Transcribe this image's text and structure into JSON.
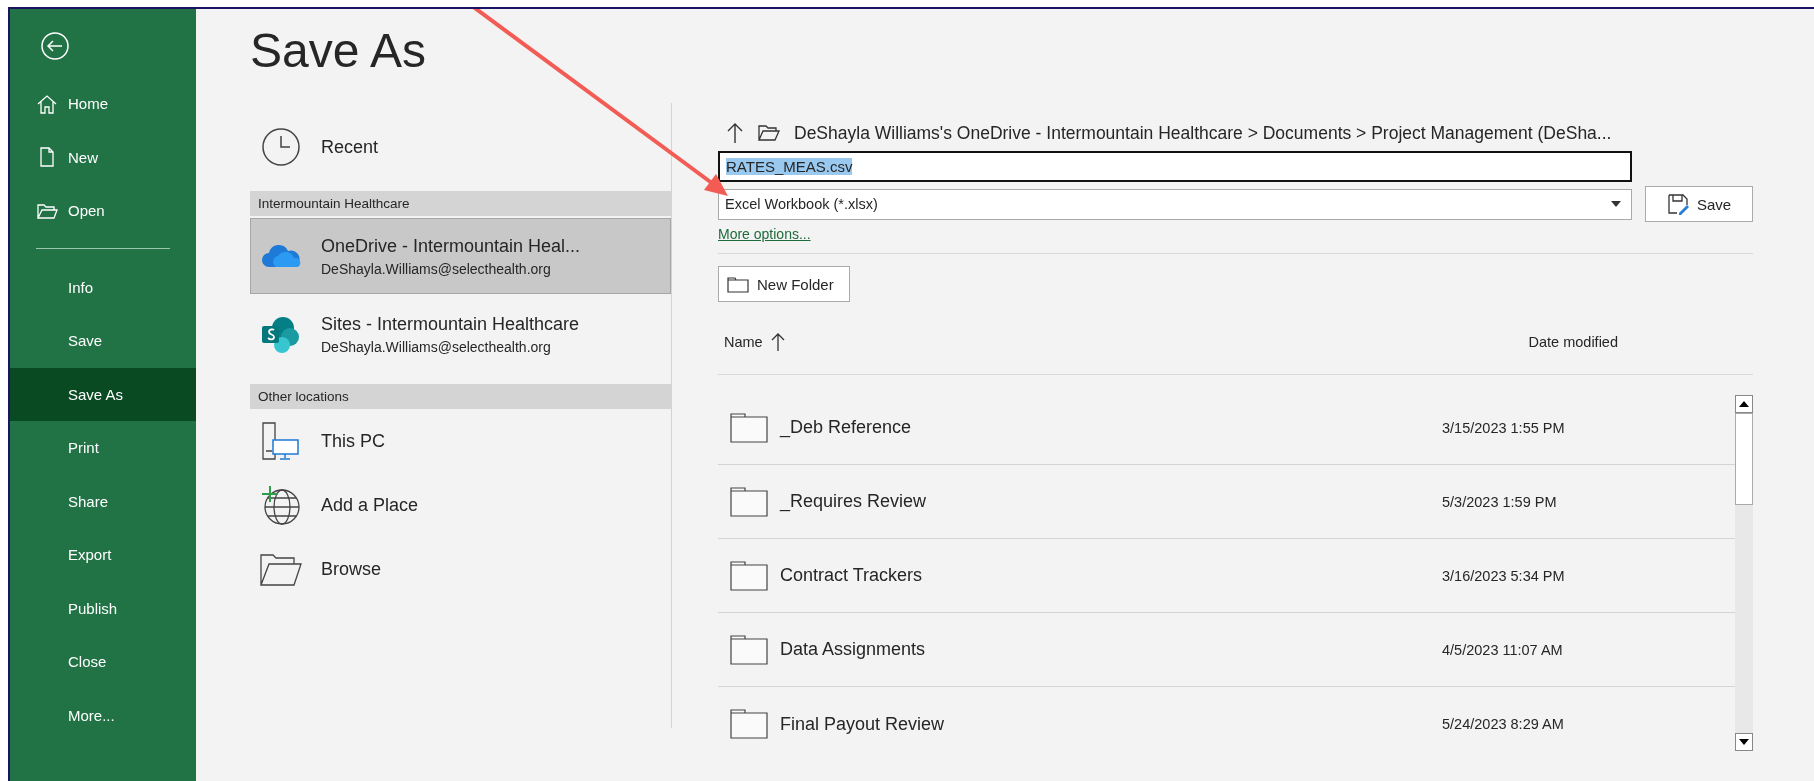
{
  "nav_top": [
    {
      "label": "Home",
      "selected": false
    },
    {
      "label": "New",
      "selected": false
    },
    {
      "label": "Open",
      "selected": false
    }
  ],
  "nav_items": [
    {
      "label": "Info",
      "selected": false
    },
    {
      "label": "Save",
      "selected": false
    },
    {
      "label": "Save As",
      "selected": true
    },
    {
      "label": "Print",
      "selected": false
    },
    {
      "label": "Share",
      "selected": false
    },
    {
      "label": "Export",
      "selected": false
    },
    {
      "label": "Publish",
      "selected": false
    },
    {
      "label": "Close",
      "selected": false
    },
    {
      "label": "More...",
      "selected": false
    }
  ],
  "title": "Save As",
  "locations": [
    {
      "kind": "recent",
      "title": "Recent",
      "selected": false
    },
    {
      "kind": "header",
      "title": "Intermountain Healthcare"
    },
    {
      "kind": "onedrive",
      "title": "OneDrive - Intermountain Heal...",
      "subtitle": "DeShayla.Williams@selecthealth.org",
      "selected": true
    },
    {
      "kind": "sites",
      "title": "Sites - Intermountain Healthcare",
      "subtitle": "DeShayla.Williams@selecthealth.org",
      "selected": false
    },
    {
      "kind": "header",
      "title": "Other locations"
    },
    {
      "kind": "pc",
      "title": "This PC",
      "selected": false
    },
    {
      "kind": "addplace",
      "title": "Add a Place",
      "selected": false
    },
    {
      "kind": "browse",
      "title": "Browse",
      "selected": false
    }
  ],
  "path": "DeShayla Williams's OneDrive - Intermountain Healthcare > Documents > Project Management (DeSha...",
  "filename": {
    "value": "RATES_MEAS.csv",
    "text_selected": true
  },
  "file_type": "Excel Workbook (*.xlsx)",
  "save_button": "Save",
  "more_options": "More options...",
  "new_folder": "New Folder",
  "columns": {
    "name": "Name",
    "date": "Date modified"
  },
  "files": [
    {
      "name": "_Deb Reference",
      "date": "3/15/2023 1:55 PM"
    },
    {
      "name": "_Requires Review",
      "date": "5/3/2023 1:59 PM"
    },
    {
      "name": "Contract Trackers",
      "date": "3/16/2023 5:34 PM"
    },
    {
      "name": "Data Assignments",
      "date": "4/5/2023 11:07 AM"
    },
    {
      "name": "Final Payout Review",
      "date": "5/24/2023 8:29 AM"
    }
  ]
}
